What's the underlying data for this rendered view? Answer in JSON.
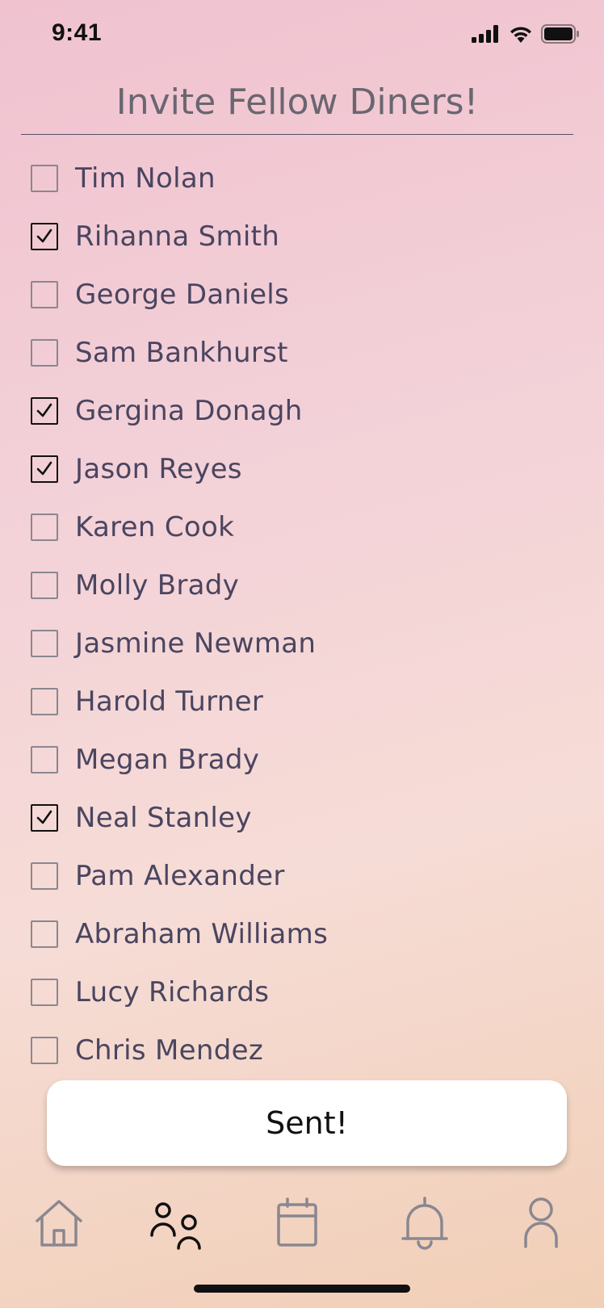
{
  "status_bar": {
    "time": "9:41"
  },
  "header": {
    "title": "Invite Fellow Diners!"
  },
  "invitees": [
    {
      "name": "Tim Nolan",
      "checked": false
    },
    {
      "name": "Rihanna Smith",
      "checked": true
    },
    {
      "name": "George Daniels",
      "checked": false
    },
    {
      "name": "Sam Bankhurst",
      "checked": false
    },
    {
      "name": "Gergina Donagh",
      "checked": true
    },
    {
      "name": "Jason Reyes",
      "checked": true
    },
    {
      "name": "Karen Cook",
      "checked": false
    },
    {
      "name": "Molly Brady",
      "checked": false
    },
    {
      "name": "Jasmine Newman",
      "checked": false
    },
    {
      "name": "Harold Turner",
      "checked": false
    },
    {
      "name": "Megan Brady",
      "checked": false
    },
    {
      "name": "Neal Stanley",
      "checked": true
    },
    {
      "name": "Pam Alexander",
      "checked": false
    },
    {
      "name": "Abraham Williams",
      "checked": false
    },
    {
      "name": "Lucy Richards",
      "checked": false
    },
    {
      "name": "Chris Mendez",
      "checked": false
    }
  ],
  "send_button": {
    "label": "Sent!"
  },
  "tab_bar": {
    "tabs": [
      {
        "icon": "home-icon",
        "active": false
      },
      {
        "icon": "friends-icon",
        "active": true
      },
      {
        "icon": "calendar-icon",
        "active": false
      },
      {
        "icon": "bell-icon",
        "active": false
      },
      {
        "icon": "profile-icon",
        "active": false
      }
    ]
  },
  "colors": {
    "background_top": "#f0c2cf",
    "background_bottom": "#f1cfb6",
    "text": "#4a4560",
    "title": "#6a6670",
    "active_icon": "#111111",
    "inactive_icon": "#8a8790"
  }
}
